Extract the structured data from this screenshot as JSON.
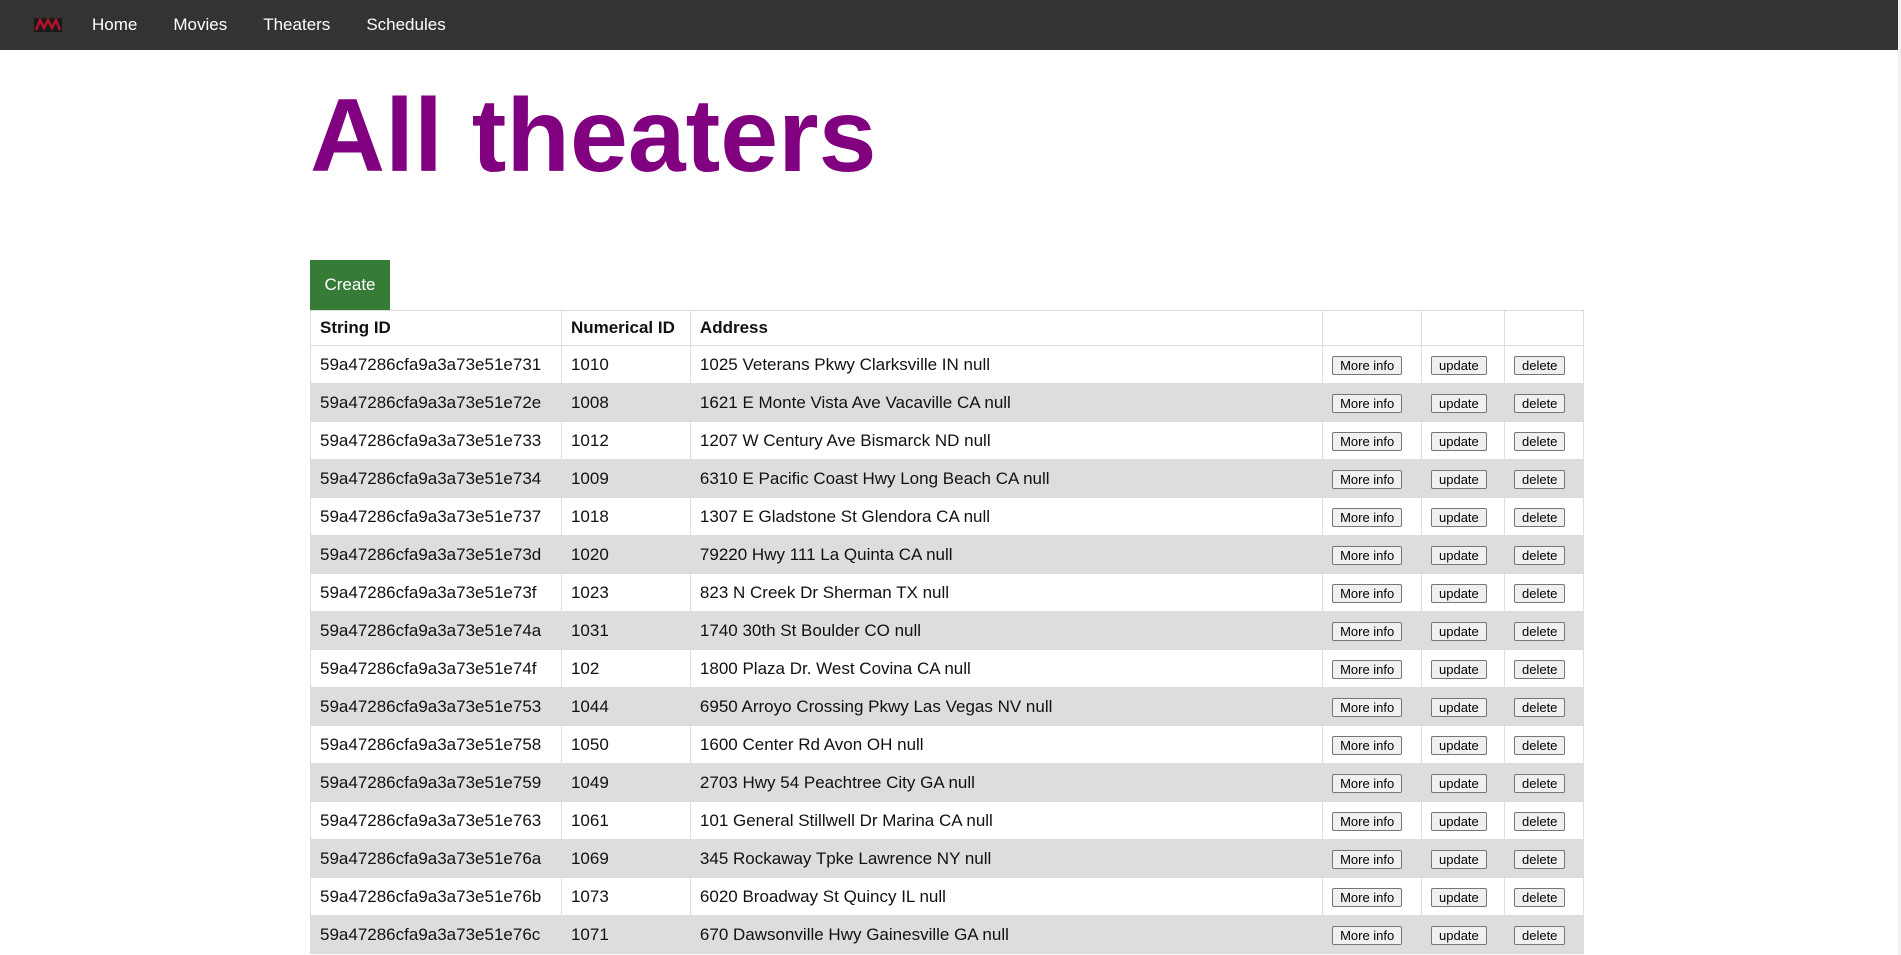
{
  "nav": {
    "links": [
      "Home",
      "Movies",
      "Theaters",
      "Schedules"
    ],
    "logo_color": "#b3122a"
  },
  "page": {
    "title": "All theaters",
    "create_label": "Create",
    "title_color": "#800080",
    "create_color": "#367c37"
  },
  "table": {
    "headers": [
      "String ID",
      "Numerical ID",
      "Address",
      "",
      "",
      ""
    ],
    "button_labels": {
      "more_info": "More info",
      "update": "update",
      "delete": "delete"
    },
    "rows": [
      [
        "59a47286cfa9a3a73e51e731",
        "1010",
        "1025 Veterans Pkwy Clarksville IN null"
      ],
      [
        "59a47286cfa9a3a73e51e72e",
        "1008",
        "1621 E Monte Vista Ave Vacaville CA null"
      ],
      [
        "59a47286cfa9a3a73e51e733",
        "1012",
        "1207 W Century Ave Bismarck ND null"
      ],
      [
        "59a47286cfa9a3a73e51e734",
        "1009",
        "6310 E Pacific Coast Hwy Long Beach CA null"
      ],
      [
        "59a47286cfa9a3a73e51e737",
        "1018",
        "1307 E Gladstone St Glendora CA null"
      ],
      [
        "59a47286cfa9a3a73e51e73d",
        "1020",
        "79220 Hwy 111 La Quinta CA null"
      ],
      [
        "59a47286cfa9a3a73e51e73f",
        "1023",
        "823 N Creek Dr Sherman TX null"
      ],
      [
        "59a47286cfa9a3a73e51e74a",
        "1031",
        "1740 30th St Boulder CO null"
      ],
      [
        "59a47286cfa9a3a73e51e74f",
        "102",
        "1800 Plaza Dr. West Covina CA null"
      ],
      [
        "59a47286cfa9a3a73e51e753",
        "1044",
        "6950 Arroyo Crossing Pkwy Las Vegas NV null"
      ],
      [
        "59a47286cfa9a3a73e51e758",
        "1050",
        "1600 Center Rd Avon OH null"
      ],
      [
        "59a47286cfa9a3a73e51e759",
        "1049",
        "2703 Hwy 54 Peachtree City GA null"
      ],
      [
        "59a47286cfa9a3a73e51e763",
        "1061",
        "101 General Stillwell Dr Marina CA null"
      ],
      [
        "59a47286cfa9a3a73e51e76a",
        "1069",
        "345 Rockaway Tpke Lawrence NY null"
      ],
      [
        "59a47286cfa9a3a73e51e76b",
        "1073",
        "6020 Broadway St Quincy IL null"
      ],
      [
        "59a47286cfa9a3a73e51e76c",
        "1071",
        "670 Dawsonville Hwy Gainesville GA null"
      ]
    ]
  }
}
